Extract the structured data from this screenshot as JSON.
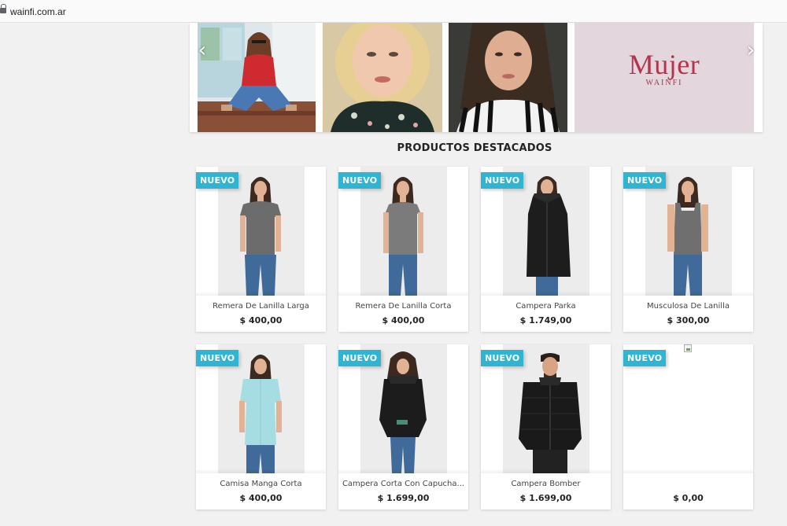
{
  "browser": {
    "url": "wainfi.com.ar"
  },
  "carousel": {
    "banner_title": "Mujer",
    "banner_subtitle": "WAINFI",
    "prev_label": "‹",
    "next_label": "›"
  },
  "featured": {
    "title": "PRODUCTOS DESTACADOS",
    "products": [
      {
        "badge": "NUEVO",
        "name": "Remera De Lanilla Larga",
        "price": "$ 400,00"
      },
      {
        "badge": "NUEVO",
        "name": "Remera De Lanilla Corta",
        "price": "$ 400,00"
      },
      {
        "badge": "NUEVO",
        "name": "Campera Parka",
        "price": "$ 1.749,00"
      },
      {
        "badge": "NUEVO",
        "name": "Musculosa De Lanilla",
        "price": "$ 300,00"
      },
      {
        "badge": "NUEVO",
        "name": "Camisa Manga Corta",
        "price": "$ 400,00"
      },
      {
        "badge": "NUEVO",
        "name": "Campera Corta Con Capucha...",
        "price": "$ 1.699,00"
      },
      {
        "badge": "NUEVO",
        "name": "Campera Bomber",
        "price": "$ 1.699,00"
      },
      {
        "badge": "NUEVO",
        "name": "",
        "price": "$ 0,00"
      }
    ]
  },
  "colors": {
    "badge": "#2fb5d2",
    "banner_text": "#b5344b",
    "page_bg": "#f1f1f1"
  }
}
